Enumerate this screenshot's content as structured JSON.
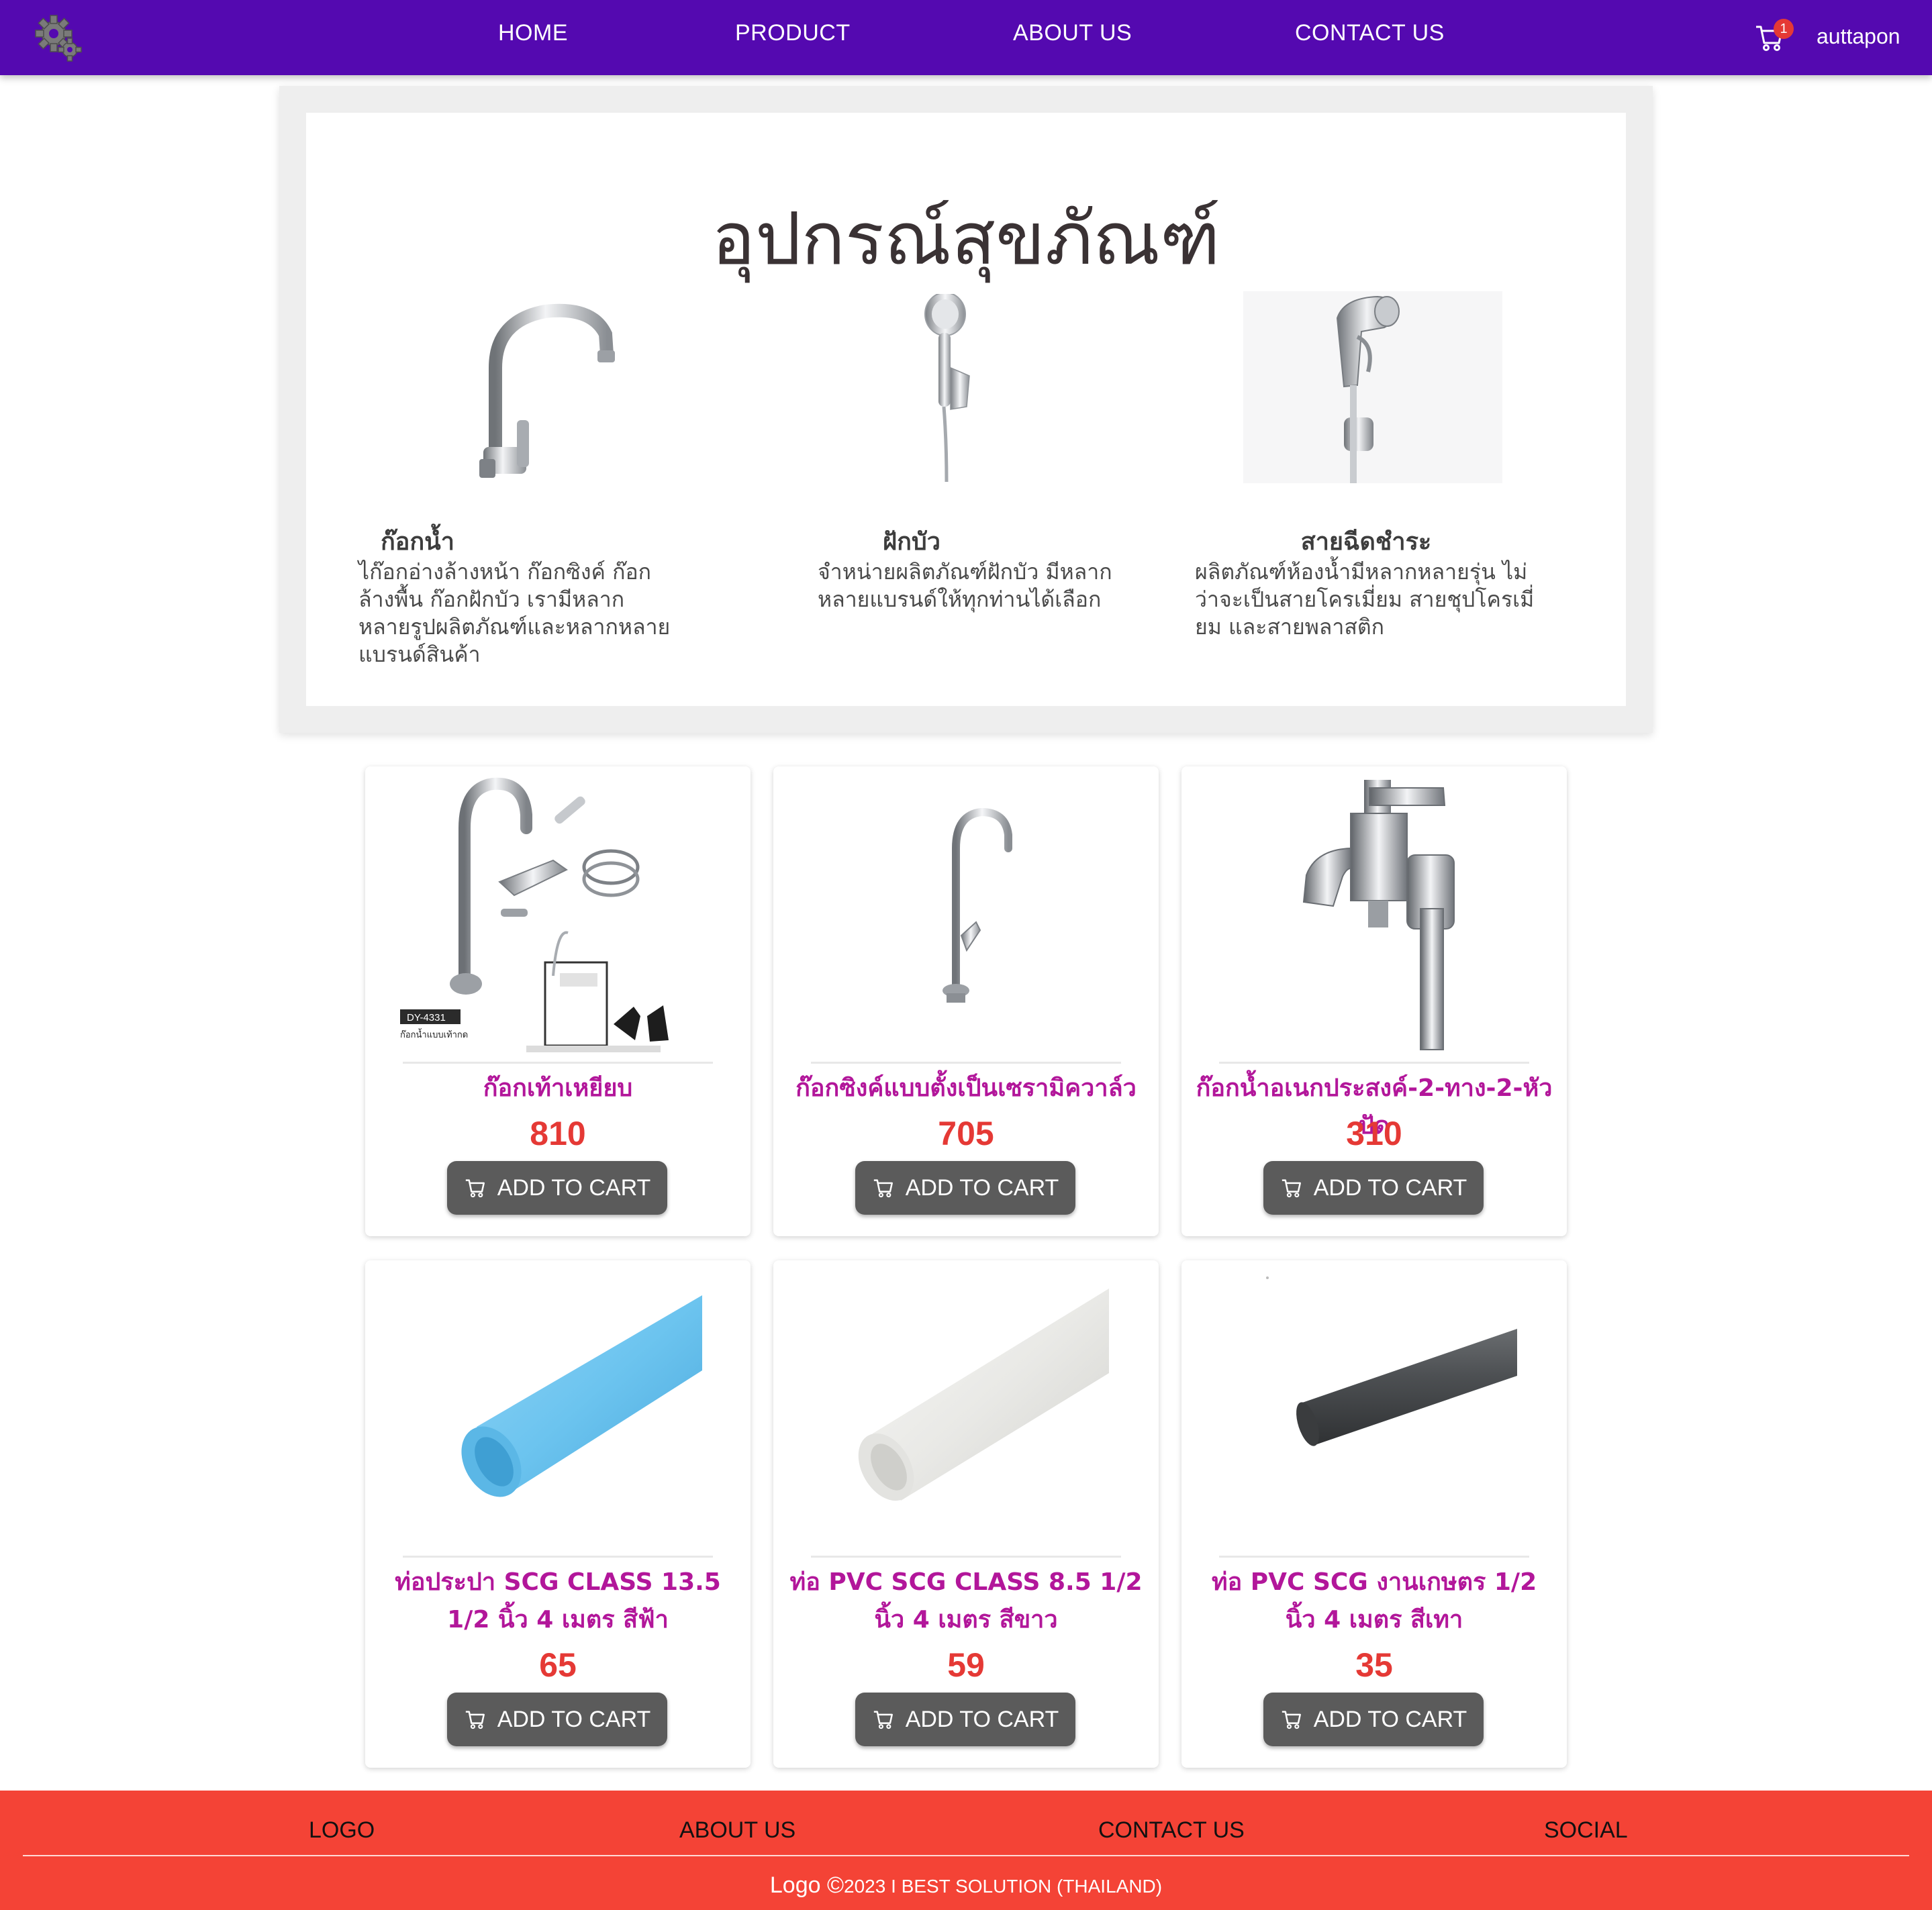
{
  "nav": {
    "links": [
      "HOME",
      "PRODUCT",
      "ABOUT US",
      "CONTACT US"
    ],
    "cart_count": "1",
    "username": "auttapon",
    "logo_icon": "gears-icon",
    "cart_icon": "shopping-cart-icon"
  },
  "hero": {
    "title": "อุปกรณ์สุขภัณฑ์",
    "categories": [
      {
        "title": "ก๊อกน้ำ",
        "description": "ไก๊อกอ่างล้างหน้า ก๊อกซิงค์ ก๊อกล้างพื้น ก๊อกฝักบัว เรามีหลากหลายรูปผลิตภัณฑ์และหลากหลายแบรนด์สินค้า",
        "image": "wall-faucet-image"
      },
      {
        "title": "ฝักบัว",
        "description": "จำหน่ายผลิตภัณฑ์ฝักบัว มีหลากหลายแบรนด์ให้ทุกท่านได้เลือก",
        "image": "hand-shower-image"
      },
      {
        "title": "สายฉีดชำระ",
        "description": "ผลิตภัณฑ์ห้องน้ำมีหลากหลายรุ่น ไม่ว่าจะเป็นสายโครเมี่ยม สายชุปโครเมี่ยม และสายพลาสติก",
        "image": "bidet-sprayer-image"
      }
    ]
  },
  "products": [
    {
      "name": "ก๊อกเท้าเหยียบ",
      "price": "810",
      "button": "ADD TO CART",
      "image_label": "DY-4331",
      "image_caption": "ก๊อกน้ำแบบเท้ากด"
    },
    {
      "name": "ก๊อกซิงค์แบบตั้งเป็นเซรามิควาล์ว",
      "price": "705",
      "button": "ADD TO CART"
    },
    {
      "name": "ก๊อกน้ำอเนกประสงค์-2-ทาง-2-หัวปัด",
      "price": "310",
      "button": "ADD TO CART"
    },
    {
      "name": "ท่อประปา SCG CLASS 13.5 1/2 นิ้ว 4 เมตร สีฟ้า",
      "price": "65",
      "button": "ADD TO CART"
    },
    {
      "name": "ท่อ PVC SCG CLASS 8.5 1/2 นิ้ว 4 เมตร สีขาว",
      "price": "59",
      "button": "ADD TO CART"
    },
    {
      "name": "ท่อ PVC SCG งานเกษตร 1/2 นิ้ว 4 เมตร สีเทา",
      "price": "35",
      "button": "ADD TO CART"
    }
  ],
  "footer": {
    "links": [
      "LOGO",
      "ABOUT US",
      "CONTACT US",
      "SOCIAL"
    ],
    "copyright_logo": "Logo ©",
    "copyright_text": "2023 I BEST SOLUTION (THAILAND)"
  },
  "colors": {
    "nav_bg": "#5409b0",
    "footer_bg": "#f44336",
    "product_name": "#b2169a",
    "price": "#e53935",
    "button_bg": "#5b5b5b"
  }
}
